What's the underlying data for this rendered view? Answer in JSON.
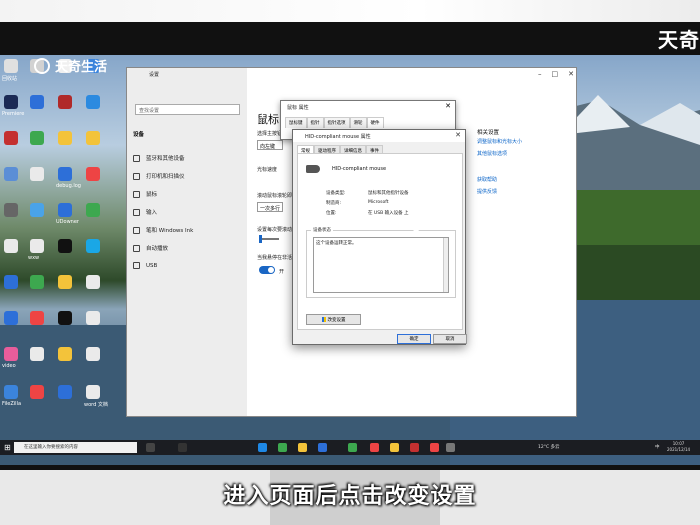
{
  "watermark": {
    "brand_left": "天奇生活",
    "brand_right": "天奇"
  },
  "subtitle": "进入页面后点击改变设置",
  "settings": {
    "title": "设置",
    "search_placeholder": "查找设置",
    "section": "设备",
    "nav": [
      "蓝牙和其他设备",
      "打印机和扫描仪",
      "鼠标",
      "输入",
      "笔和 Windows Ink",
      "自动播放",
      "USB"
    ],
    "content_title": "鼠标",
    "labels": [
      "选择主按钮",
      "光标速度",
      "滚动鼠标滚轮即可滚动",
      "设置每次要滚动的行数",
      "当我悬停在非活动窗口上方时对其进行滚动"
    ],
    "primary_button": "向左键",
    "scroll_option": "一次多行",
    "toggle_state": "开",
    "related_heading": "相关设置",
    "related_links": [
      "调整鼠标和光标大小",
      "其他鼠标选项"
    ],
    "help_links": [
      "获取帮助",
      "提供反馈"
    ]
  },
  "mouse_properties": {
    "title": "鼠标 属性",
    "tabs": [
      "鼠标键",
      "指针",
      "指针选项",
      "滑轮",
      "硬件"
    ],
    "active_tab": "硬件"
  },
  "hid_dialog": {
    "title": "HID-compliant mouse 属性",
    "tabs": [
      "常规",
      "驱动程序",
      "详细信息",
      "事件"
    ],
    "active_tab": "常规",
    "device_name": "HID-compliant mouse",
    "fields": [
      {
        "label": "设备类型:",
        "value": "鼠标和其他指针设备"
      },
      {
        "label": "制造商:",
        "value": "Microsoft"
      },
      {
        "label": "位置:",
        "value": "在 USB 输入设备 上"
      }
    ],
    "status_caption": "设备状态",
    "status_text": "这个设备运转正常。",
    "change_button": "改变设置",
    "ok": "确定",
    "cancel": "取消"
  },
  "taskbar": {
    "search_placeholder": "在这里输入你要搜索的内容",
    "weather": "12°C 多云",
    "ime": "中",
    "time": "10:07",
    "date": "2021/12/14"
  },
  "desktop_icons": [
    "回收站",
    "Premiere",
    "debug.log",
    "UDowner",
    "wxw",
    "video",
    "FileZilla",
    "word 文档"
  ]
}
